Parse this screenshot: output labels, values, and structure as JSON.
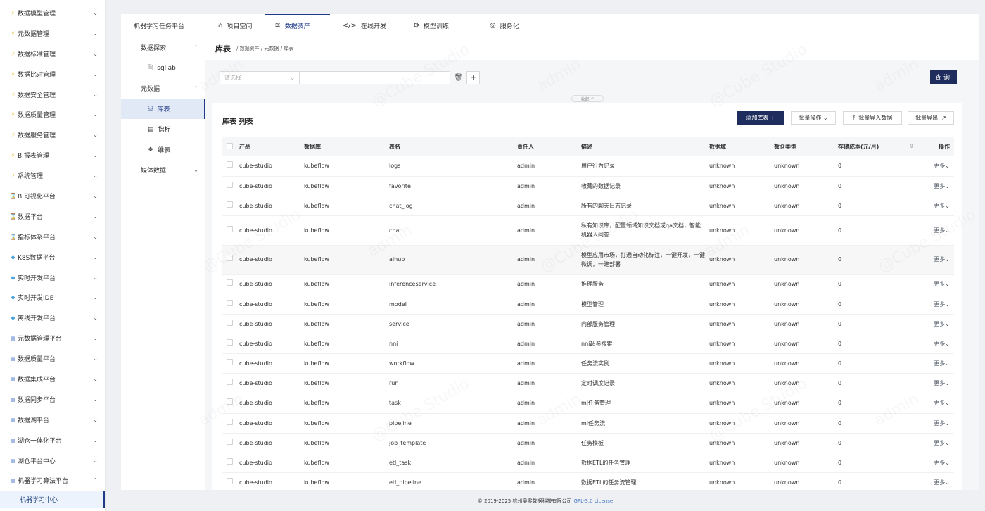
{
  "sidebar": {
    "items": [
      {
        "label": "数据模型管理",
        "icon": "⚡",
        "icon_color": "#e6b422"
      },
      {
        "label": "元数据管理",
        "icon": "⚡",
        "icon_color": "#e6b422"
      },
      {
        "label": "数据标准管理",
        "icon": "⚡",
        "icon_color": "#e6b422"
      },
      {
        "label": "数据比对管理",
        "icon": "⚡",
        "icon_color": "#e6b422"
      },
      {
        "label": "数据安全管理",
        "icon": "⚡",
        "icon_color": "#e6b422"
      },
      {
        "label": "数据质量管理",
        "icon": "⚡",
        "icon_color": "#e6b422"
      },
      {
        "label": "数据服务管理",
        "icon": "⚡",
        "icon_color": "#e6b422"
      },
      {
        "label": "BI报表管理",
        "icon": "⚡",
        "icon_color": "#e6b422"
      },
      {
        "label": "系统管理",
        "icon": "⚡",
        "icon_color": "#e6b422"
      },
      {
        "label": "BI可视化平台",
        "icon": "⌛",
        "icon_color": "#c9a227"
      },
      {
        "label": "数据平台",
        "icon": "⌛",
        "icon_color": "#c9a227"
      },
      {
        "label": "指标体系平台",
        "icon": "⌛",
        "icon_color": "#c9a227"
      },
      {
        "label": "K8S数据平台",
        "icon": "◆",
        "icon_color": "#4aa3df"
      },
      {
        "label": "实时开发平台",
        "icon": "◆",
        "icon_color": "#4aa3df"
      },
      {
        "label": "实时开发IDE",
        "icon": "◆",
        "icon_color": "#4aa3df"
      },
      {
        "label": "离线开发平台",
        "icon": "◆",
        "icon_color": "#4aa3df"
      },
      {
        "label": "元数据管理平台",
        "icon": "▤",
        "icon_color": "#4a78c8"
      },
      {
        "label": "数据质量平台",
        "icon": "▤",
        "icon_color": "#4a78c8"
      },
      {
        "label": "数据集成平台",
        "icon": "▤",
        "icon_color": "#4a78c8"
      },
      {
        "label": "数据同步平台",
        "icon": "▤",
        "icon_color": "#4a78c8"
      },
      {
        "label": "数据湖平台",
        "icon": "▤",
        "icon_color": "#4a78c8"
      },
      {
        "label": "湖仓一体化平台",
        "icon": "▤",
        "icon_color": "#4a78c8"
      },
      {
        "label": "湖仓平台中心",
        "icon": "▤",
        "icon_color": "#4a78c8"
      },
      {
        "label": "机器学习算法平台",
        "icon": "▤",
        "icon_color": "#4a78c8"
      }
    ],
    "active_sub": "机器学习中心"
  },
  "topnav": {
    "brand": "机器学习任务平台",
    "tabs": [
      {
        "label": "项目空间",
        "icon": "⌂"
      },
      {
        "label": "数据资产",
        "icon": "≋"
      },
      {
        "label": "在线开发",
        "icon": "</>"
      },
      {
        "label": "模型训练",
        "icon": "⚙"
      },
      {
        "label": "服务化",
        "icon": "◎"
      }
    ]
  },
  "subside": {
    "group1": "数据探索",
    "item_sqllab": "sqllab",
    "group2": "元数据",
    "item_table": "库表",
    "item_metric": "指标",
    "item_dim": "维表",
    "group3": "媒体数据"
  },
  "page": {
    "title": "库表",
    "breadcrumb": "/ 数据资产 / 元数据 / 库表"
  },
  "filter": {
    "select_placeholder": "请选择",
    "query_label": "查询",
    "collapse_label": "收起 ^"
  },
  "panel": {
    "title": "库表 列表",
    "add_label": "添加库表 +",
    "batch_label": "批量操作 ⌄",
    "import_label": "批量导入数据",
    "export_label": "批量导出"
  },
  "table": {
    "headers": [
      "产品",
      "数据库",
      "表名",
      "责任人",
      "描述",
      "数据域",
      "数仓类型",
      "存储成本(元/月)",
      "操作"
    ],
    "more_label": "更多⌄",
    "rows": [
      [
        "cube-studio",
        "kubeflow",
        "logs",
        "admin",
        "用户行为记录",
        "unknown",
        "unknown",
        "0"
      ],
      [
        "cube-studio",
        "kubeflow",
        "favorite",
        "admin",
        "收藏的数据记录",
        "unknown",
        "unknown",
        "0"
      ],
      [
        "cube-studio",
        "kubeflow",
        "chat_log",
        "admin",
        "所有的聊天日志记录",
        "unknown",
        "unknown",
        "0"
      ],
      [
        "cube-studio",
        "kubeflow",
        "chat",
        "admin",
        "私有知识库，配置领域知识文档或qa文档，智能机器人问答",
        "unknown",
        "unknown",
        "0"
      ],
      [
        "cube-studio",
        "kubeflow",
        "aihub",
        "admin",
        "模型应用市场，打通自动化标注，一键开发，一键微调，一建部署",
        "unknown",
        "unknown",
        "0"
      ],
      [
        "cube-studio",
        "kubeflow",
        "inferenceservice",
        "admin",
        "推理服务",
        "unknown",
        "unknown",
        "0"
      ],
      [
        "cube-studio",
        "kubeflow",
        "model",
        "admin",
        "模型管理",
        "unknown",
        "unknown",
        "0"
      ],
      [
        "cube-studio",
        "kubeflow",
        "service",
        "admin",
        "内部服务管理",
        "unknown",
        "unknown",
        "0"
      ],
      [
        "cube-studio",
        "kubeflow",
        "nni",
        "admin",
        "nni超参搜索",
        "unknown",
        "unknown",
        "0"
      ],
      [
        "cube-studio",
        "kubeflow",
        "workflow",
        "admin",
        "任务流实例",
        "unknown",
        "unknown",
        "0"
      ],
      [
        "cube-studio",
        "kubeflow",
        "run",
        "admin",
        "定时调度记录",
        "unknown",
        "unknown",
        "0"
      ],
      [
        "cube-studio",
        "kubeflow",
        "task",
        "admin",
        "ml任务管理",
        "unknown",
        "unknown",
        "0"
      ],
      [
        "cube-studio",
        "kubeflow",
        "pipeline",
        "admin",
        "ml任务流",
        "unknown",
        "unknown",
        "0"
      ],
      [
        "cube-studio",
        "kubeflow",
        "job_template",
        "admin",
        "任务模板",
        "unknown",
        "unknown",
        "0"
      ],
      [
        "cube-studio",
        "kubeflow",
        "etl_task",
        "admin",
        "数据ETL的任务管理",
        "unknown",
        "unknown",
        "0"
      ],
      [
        "cube-studio",
        "kubeflow",
        "etl_pipeline",
        "admin",
        "数据ETL的任务流管理",
        "unknown",
        "unknown",
        "0"
      ]
    ]
  },
  "footer": {
    "copyright": "© 2019-2025 杭州奥零数据科技有限公司",
    "license": "GPL-3.0 License"
  },
  "watermark": [
    "admin",
    "@Cube Studio"
  ],
  "colors": {
    "primary": "#1e2d5e",
    "accent": "#1e3a8a"
  }
}
